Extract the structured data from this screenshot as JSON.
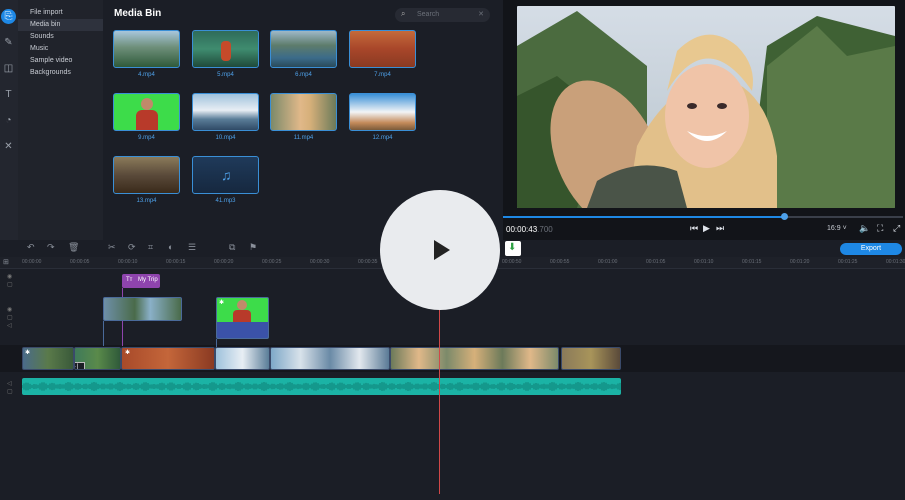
{
  "tools": {
    "import": "import-icon",
    "filters": "wand-icon",
    "transitions": "transitions-icon",
    "titles": "titles-icon",
    "stickers": "stickers-icon",
    "more": "more-tools-icon"
  },
  "sidebar": {
    "items": [
      {
        "label": "File import",
        "active": false
      },
      {
        "label": "Media bin",
        "active": true
      },
      {
        "label": "Sounds",
        "active": false
      },
      {
        "label": "Music",
        "active": false
      },
      {
        "label": "Sample video",
        "active": false
      },
      {
        "label": "Backgrounds",
        "active": false
      }
    ]
  },
  "media_bin": {
    "title": "Media Bin",
    "search_placeholder": "Search",
    "files": [
      {
        "name": "4.mp4"
      },
      {
        "name": "5.mp4"
      },
      {
        "name": "6.mp4"
      },
      {
        "name": "7.mp4"
      },
      {
        "name": "9.mp4"
      },
      {
        "name": "10.mp4"
      },
      {
        "name": "11.mp4"
      },
      {
        "name": "12.mp4"
      },
      {
        "name": "13.mp4"
      },
      {
        "name": "41.mp3"
      }
    ]
  },
  "player": {
    "timecode": "00:00:43",
    "timecode_ms": ".700",
    "progress": 0.7,
    "aspect_ratio": "16:9 ˅"
  },
  "timeline": {
    "export_label": "Export",
    "title_clip_label": "My Trip",
    "ruler": [
      "00:00:00",
      "00:00:05",
      "00:00:10",
      "00:00:15",
      "00:00:20",
      "00:00:25",
      "00:00:30",
      "00:00:35",
      "00:00:40",
      "00:00:45",
      "00:00:50",
      "00:00:55",
      "00:01:00",
      "00:01:05",
      "00:01:10",
      "00:01:15",
      "00:01:20",
      "00:01:25",
      "00:01:30"
    ]
  },
  "colors": {
    "accent": "#1e88e5",
    "title_clip": "#8e44ad",
    "audio_clip": "#1bb3a5",
    "chroma_green": "#3ddc4a"
  }
}
